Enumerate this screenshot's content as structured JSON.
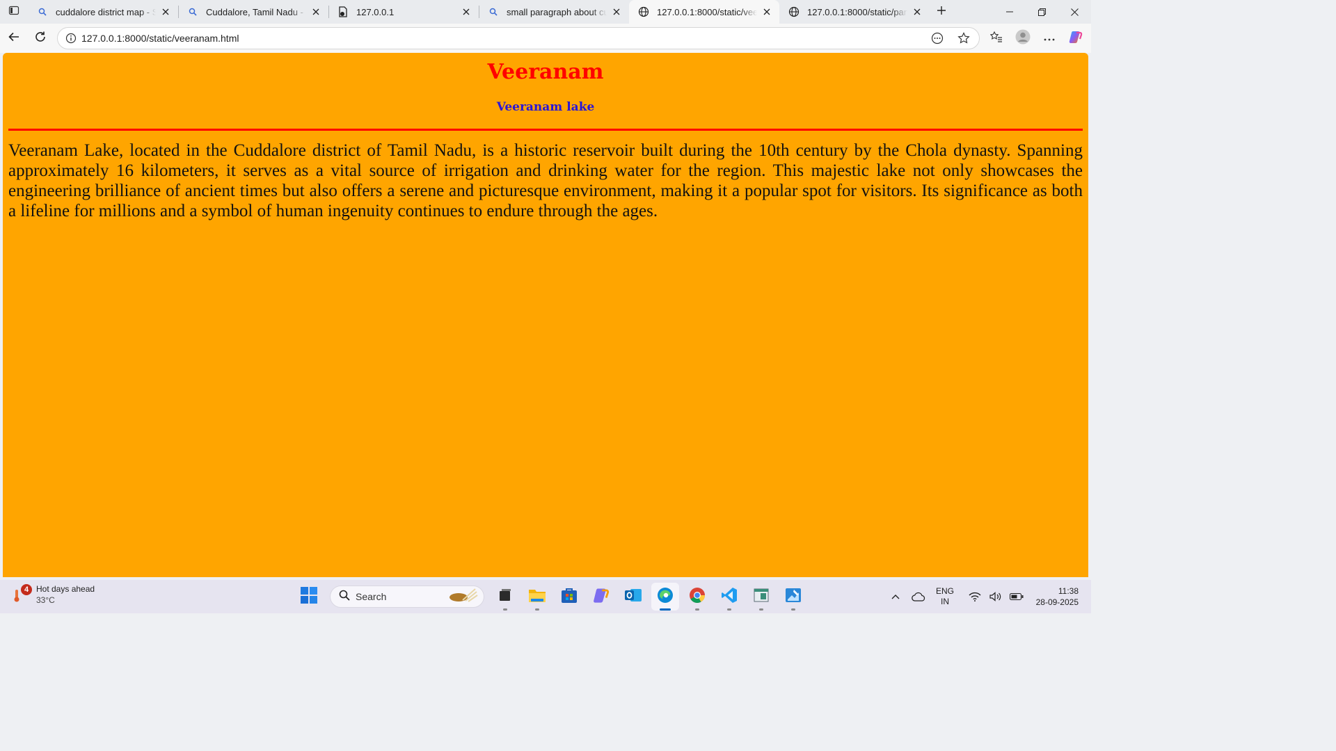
{
  "browser": {
    "tabs": [
      {
        "title": "cuddalore district map - Sear",
        "favicon": "search-icon",
        "active": false
      },
      {
        "title": "Cuddalore, Tamil Nadu - Bing",
        "favicon": "search-icon",
        "active": false
      },
      {
        "title": "127.0.0.1",
        "favicon": "file-icon",
        "active": false
      },
      {
        "title": "small paragraph about cudd",
        "favicon": "search-icon",
        "active": false
      },
      {
        "title": "127.0.0.1:8000/static/veeranam",
        "favicon": "globe-icon",
        "active": true
      },
      {
        "title": "127.0.0.1:8000/static/panruti",
        "favicon": "globe-icon",
        "active": false
      }
    ],
    "address": {
      "url": "127.0.0.1:8000/static/veeranam.html"
    }
  },
  "page": {
    "heading": "Veeranam",
    "subheading": "Veeranam lake",
    "paragraph": "Veeranam Lake, located in the Cuddalore district of Tamil Nadu, is a historic reservoir built during the 10th century by the Chola dynasty. Spanning approximately 16 kilometers, it serves as a vital source of irrigation and drinking water for the region. This majestic lake not only showcases the engineering brilliance of ancient times but also offers a serene and picturesque environment, making it a popular spot for visitors. Its significance as both a lifeline for millions and a symbol of human ingenuity continues to endure through the ages.",
    "colors": {
      "background": "#ffa500",
      "heading": "#ff0000",
      "subheading": "#2a16d8",
      "rule": "#ff0000"
    }
  },
  "taskbar": {
    "weather": {
      "badge": "4",
      "title": "Hot days ahead",
      "temp": "33°C"
    },
    "search_placeholder": "Search",
    "lang": {
      "line1": "ENG",
      "line2": "IN"
    },
    "clock": {
      "time": "11:38",
      "date": "28-09-2025"
    }
  }
}
